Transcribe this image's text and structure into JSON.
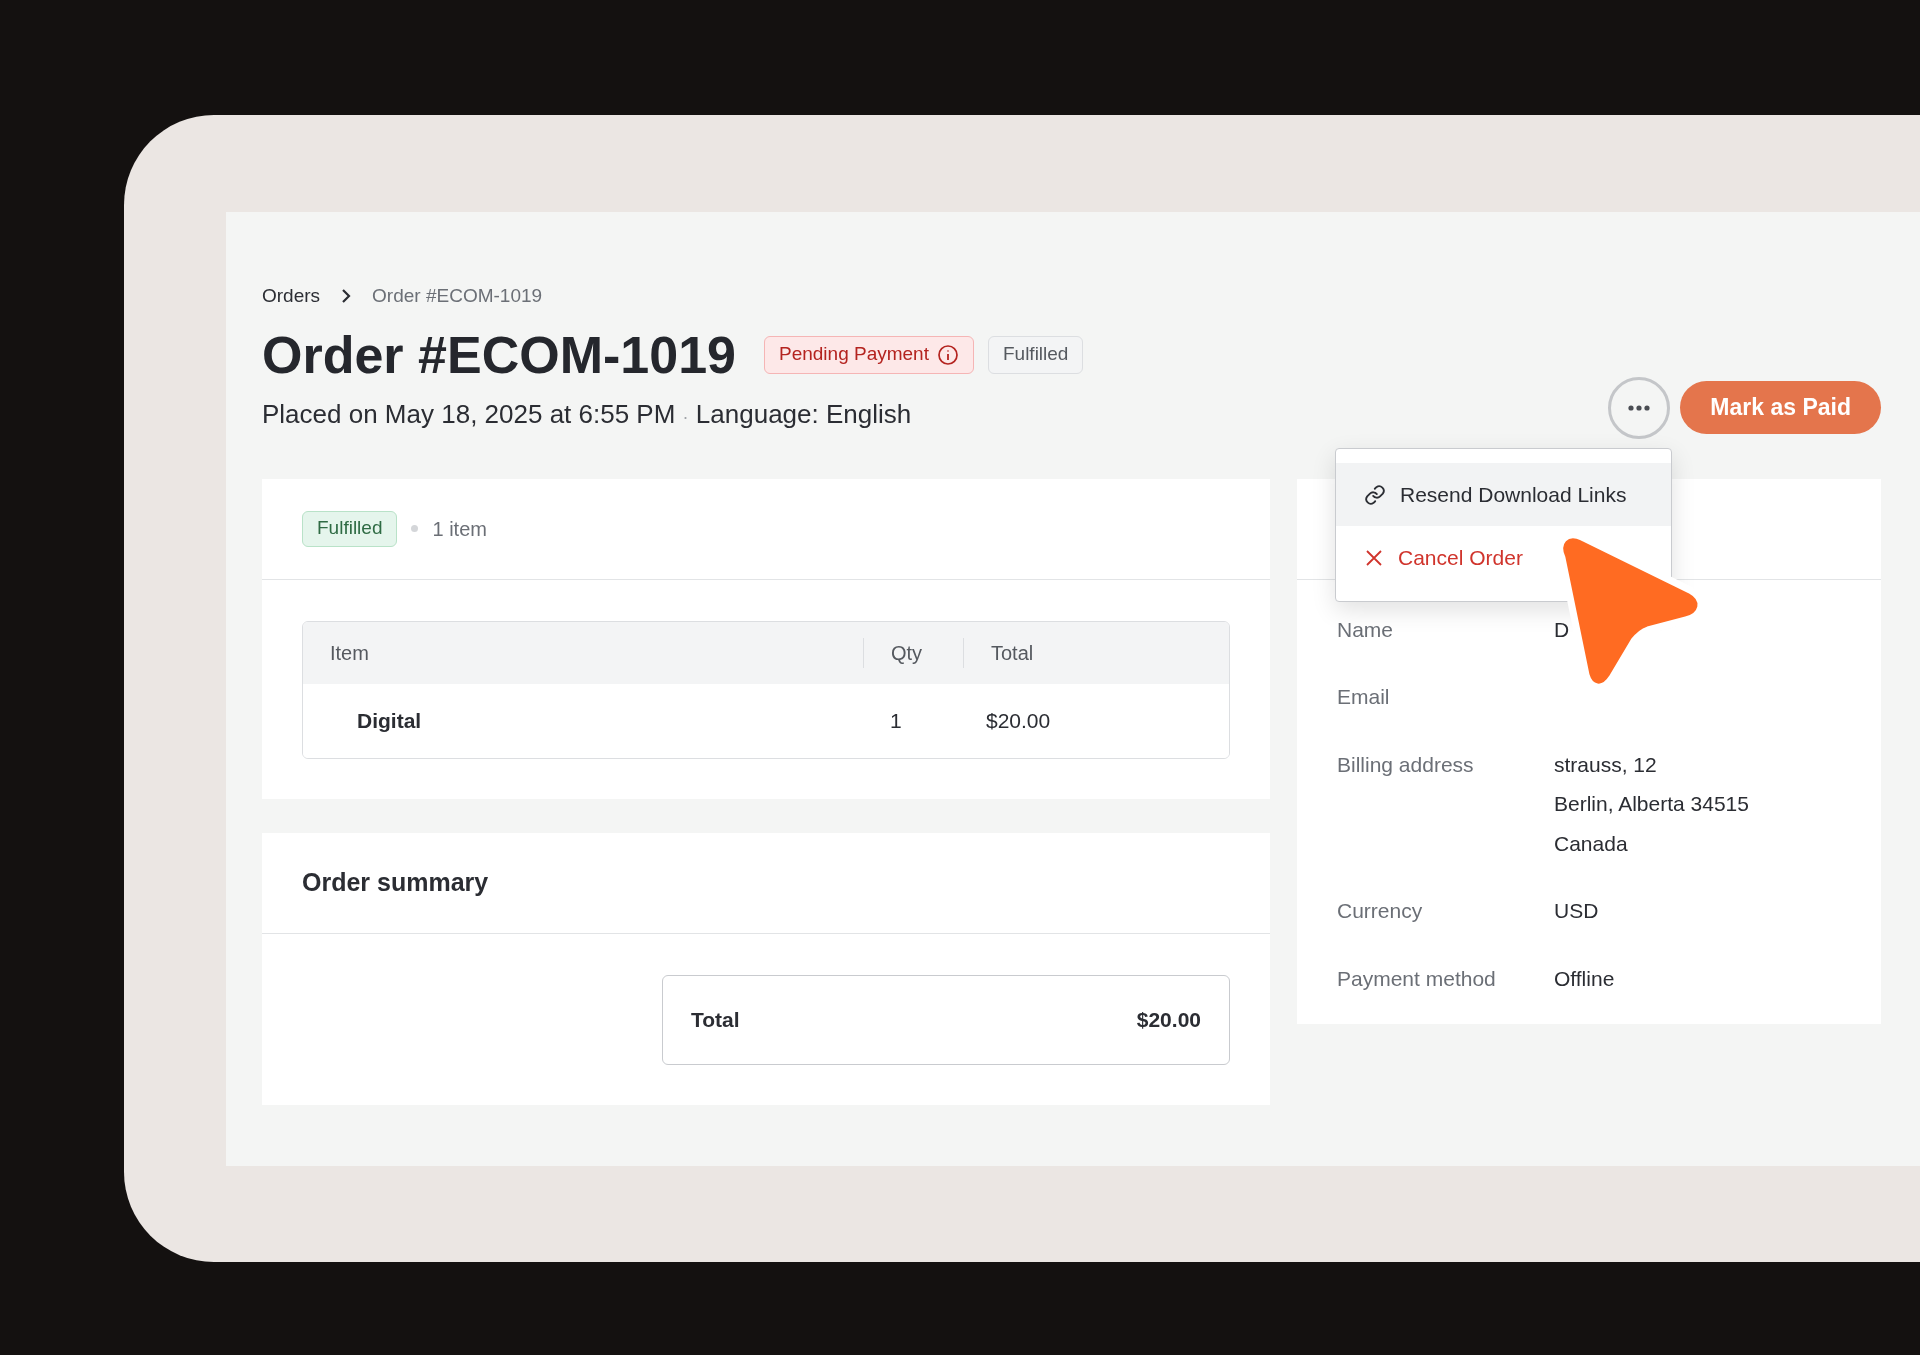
{
  "breadcrumb": [
    {
      "label": "Orders"
    },
    {
      "label": "Order #ECOM-1019"
    }
  ],
  "title": "Order #ECOM-1019",
  "badges": [
    {
      "label": "Pending Payment",
      "kind": "payment"
    },
    {
      "label": "Fulfilled",
      "kind": "neutral"
    }
  ],
  "subtitle": {
    "placed": "Placed on May 18, 2025 at 6:55 PM",
    "separator": "·",
    "language": "Language: English"
  },
  "primary_button": "Mark as Paid",
  "menu": {
    "items": [
      {
        "label": "Resend Download Links",
        "kind": "link",
        "selected": true
      },
      {
        "label": "Cancel Order",
        "kind": "danger",
        "selected": false
      }
    ]
  },
  "fulfillment": {
    "status": "Fulfilled",
    "count": "1 item",
    "columns": [
      "Item",
      "Qty",
      "Total"
    ],
    "rows": [
      [
        "Digital",
        "1",
        "$20.00"
      ]
    ]
  },
  "summary": {
    "title": "Order summary",
    "total_label": "Total",
    "total_value": "$20.00"
  },
  "details": [
    {
      "label": "Name",
      "lines": [
        "D"
      ]
    },
    {
      "label": "Email"
    },
    {
      "label": "Billing address",
      "lines": [
        "strauss, 12",
        "Berlin, Alberta 34515",
        "Canada"
      ]
    },
    {
      "label": "Currency",
      "lines": [
        "USD"
      ]
    },
    {
      "label": "Payment method",
      "lines": [
        "Offline"
      ]
    }
  ]
}
